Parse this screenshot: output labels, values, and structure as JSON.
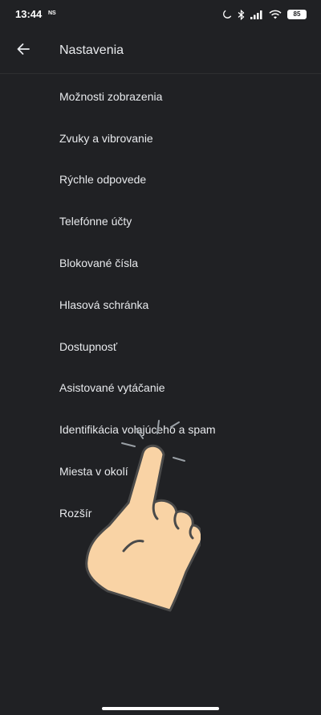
{
  "status_bar": {
    "time": "13:44",
    "carrier_badge": "NS",
    "battery": "85",
    "icons": [
      "moon-icon",
      "bluetooth-icon",
      "signal-icon",
      "wifi-icon",
      "battery-icon"
    ]
  },
  "app_bar": {
    "back_icon": "arrow-back-icon",
    "title": "Nastavenia"
  },
  "settings": {
    "items": [
      {
        "label": "Možnosti zobrazenia"
      },
      {
        "label": "Zvuky a vibrovanie"
      },
      {
        "label": "Rýchle odpovede"
      },
      {
        "label": "Telefónne účty"
      },
      {
        "label": "Blokované čísla"
      },
      {
        "label": "Hlasová schránka"
      },
      {
        "label": "Dostupnosť"
      },
      {
        "label": "Asistované vytáčanie"
      },
      {
        "label": "Identifikácia volajúceho a spam"
      },
      {
        "label": "Miesta v okolí"
      },
      {
        "label": "Rozšír"
      }
    ]
  },
  "overlay": {
    "icon": "tap-hand-icon"
  },
  "colors": {
    "background": "#202124",
    "text": "#e8eaed",
    "hand_fill": "#f9d3a5"
  }
}
